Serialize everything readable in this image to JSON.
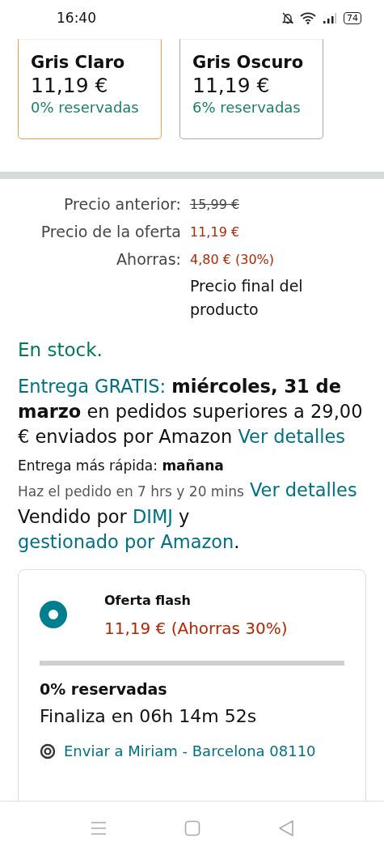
{
  "status_bar": {
    "time": "16:40",
    "battery": "74"
  },
  "variants": [
    {
      "name": "Gris Claro",
      "price": "11,19 €",
      "reserved": "0% reservadas",
      "selected": true
    },
    {
      "name": "Gris Oscuro",
      "price": "11,19 €",
      "reserved": "6% reservadas",
      "selected": false
    }
  ],
  "prices": [
    {
      "label": "Precio anterior:",
      "value": "15,99 €",
      "kind": "old"
    },
    {
      "label": "Precio de la oferta",
      "value": "11,19 €",
      "kind": "deal"
    },
    {
      "label": "Ahorras:",
      "value": "4,80 € (30%)",
      "kind": "deal",
      "note": "Precio final del producto"
    }
  ],
  "stock": "En stock.",
  "delivery": {
    "lead": "Entrega GRATIS:",
    "text": "**miércoles, 31 de marzo** en pedidos superiores a 29,00 € enviados por Amazon",
    "link": "Ver detalles"
  },
  "fastest": {
    "text": "Entrega más rápida: **mañana**"
  },
  "order_by": {
    "text": "Haz el pedido en 7 hrs y 20 mins",
    "link": "Ver detalles"
  },
  "seller": [
    {
      "kind": "text",
      "text": "Vendido por"
    },
    {
      "kind": "link",
      "text": "DIMJ"
    },
    {
      "kind": "text",
      "text": "y"
    },
    {
      "kind": "link",
      "text": "gestionado por Amazon"
    },
    {
      "kind": "punct",
      "text": "."
    }
  ],
  "flash": {
    "selected": true,
    "title": "Oferta flash",
    "price": "11,19 € (Ahorras 30%)",
    "level": 0,
    "reserved": "0% reservadas",
    "ends": "Finaliza en 06h 14m 52s",
    "ship_to": "Enviar a Miriam - Barcelona 08110"
  }
}
